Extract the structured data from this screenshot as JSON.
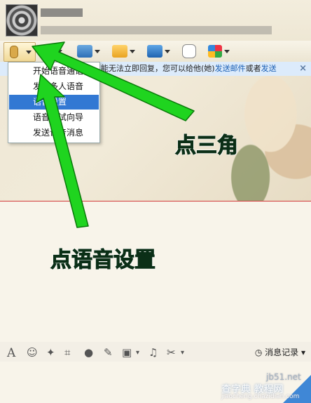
{
  "menu": {
    "items": [
      {
        "label": "开始语音通话",
        "selected": false
      },
      {
        "label": "发起多人语音",
        "selected": false
      },
      {
        "label": "语音设置",
        "selected": true
      },
      {
        "label": "语音测试向导",
        "selected": false
      },
      {
        "label": "发送语音消息",
        "selected": false
      }
    ]
  },
  "info_bar": {
    "text": "能无法立即回复，您可以给他(她)",
    "link1": "发送邮件",
    "mid": "或者",
    "link2": "发送",
    "close": "×"
  },
  "annotations": {
    "step1": "点三角",
    "step2": "点语音设置"
  },
  "bottom_bar": {
    "history_label": "消息记录",
    "history_caret": "▾"
  },
  "watermarks": {
    "site1": "jb51.net",
    "site2": "查字典 教程网",
    "site3": "jiaocheng.chazidian.com"
  },
  "colors": {
    "arrow": "#1fd41f",
    "menu_selected": "#3278d3",
    "divider": "#d23b3b"
  }
}
